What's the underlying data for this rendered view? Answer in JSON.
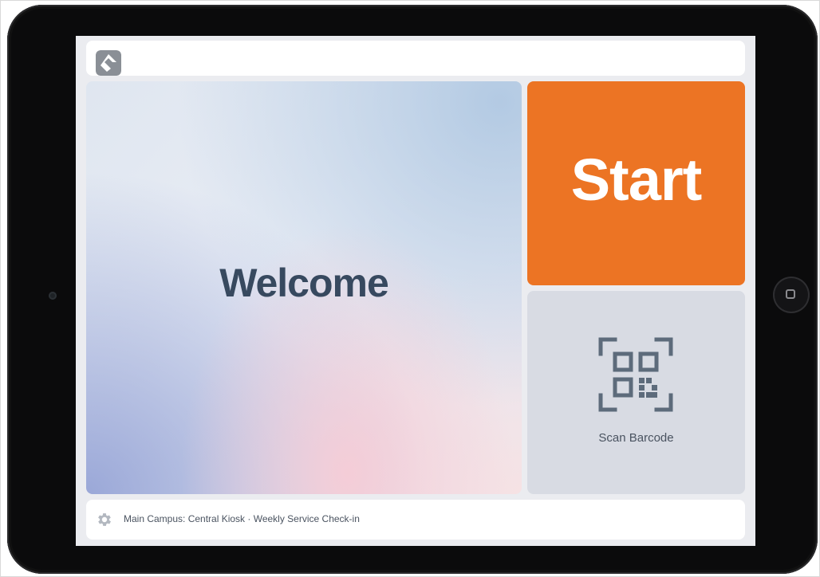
{
  "welcome": {
    "title": "Welcome"
  },
  "actions": {
    "start_label": "Start",
    "scan_label": "Scan Barcode"
  },
  "footer": {
    "kiosk_info": "Main Campus: Central Kiosk · Weekly Service Check-in"
  },
  "icons": {
    "logo": "app-logo-icon",
    "qr": "qr-scan-icon",
    "settings": "gear-icon"
  },
  "colors": {
    "accent": "#ec7424",
    "title_text": "#37495f",
    "scan_tile": "#d8dbe3",
    "device_bezel": "#0b0b0c"
  }
}
